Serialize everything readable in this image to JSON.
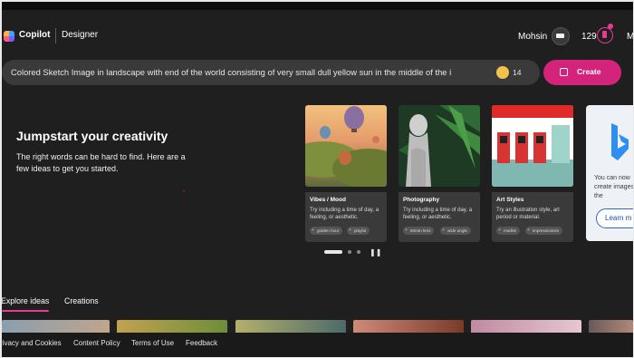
{
  "header": {
    "app_name": "Copilot",
    "product": "Designer",
    "user_name": "Mohsin",
    "reward_count": "129",
    "more_initial": "M"
  },
  "prompt": {
    "text": "Colored Sketch Image in landscape with end of the world consisting of  very small dull yellow sun in the middle of the i",
    "boosts": "14",
    "create_label": "Create"
  },
  "hero": {
    "title": "Jumpstart your creativity",
    "subtitle": "The right words can be hard to find. Here are a few ideas to get you started."
  },
  "cards": [
    {
      "title": "Vibes / Mood",
      "description": "Try including a time of day, a feeling, or aesthetic.",
      "chips": [
        "golden hour",
        "playful"
      ]
    },
    {
      "title": "Photography",
      "description": "Try including a time of day, a feeling, or aesthetic.",
      "chips": [
        "50mm lens",
        "wide angle"
      ]
    },
    {
      "title": "Art Styles",
      "description": "Try an illustration style, art period or material.",
      "chips": [
        "marble",
        "impressionism"
      ]
    }
  ],
  "bing_card": {
    "text": "You can now create images in the",
    "button": "Learn m"
  },
  "carousel": {
    "pages": 3,
    "active_page": 1
  },
  "tabs": [
    "Explore ideas",
    "Creations"
  ],
  "footer": [
    "rivacy and Cookies",
    "Content Policy",
    "Terms of Use",
    "Feedback"
  ],
  "colors": {
    "accent": "#d4237b",
    "background": "#1f1f1f",
    "surface": "#3a3a3a"
  },
  "icons": [
    "copilot-logo-icon",
    "avatar-icon",
    "rewards-icon",
    "boost-icon",
    "create-icon",
    "pause-icon",
    "bing-logo-icon"
  ]
}
